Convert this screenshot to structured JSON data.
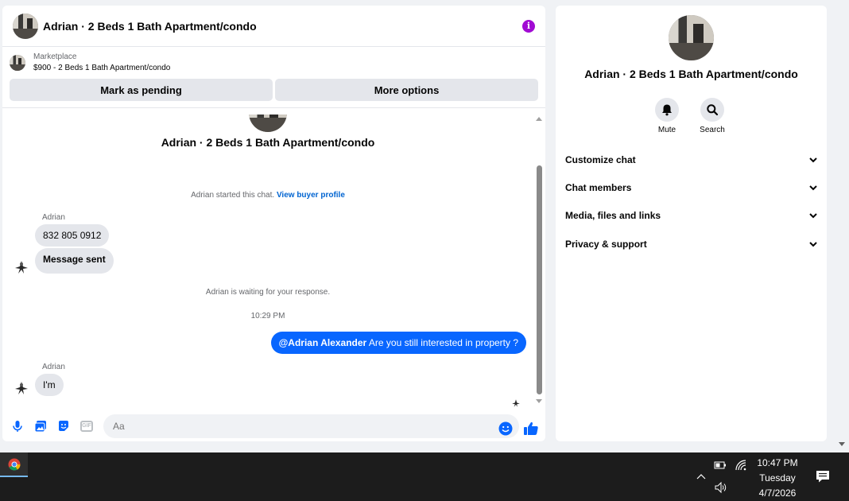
{
  "chat": {
    "header_title": "Adrian · 2 Beds 1 Bath Apartment/condo",
    "info_icon": "i",
    "marketplace_label": "Marketplace",
    "listing": "$900 - 2 Beds 1 Bath Apartment/condo",
    "actions": [
      "Mark as pending",
      "More options"
    ],
    "conversation_title": "Adrian · 2 Beds 1 Bath Apartment/condo",
    "started_text": "Adrian started this chat.",
    "view_profile": "View buyer profile",
    "messages_group1": {
      "sender": "Adrian",
      "bubbles": [
        "832 805 0912",
        "Message sent"
      ]
    },
    "waiting_text": "Adrian is waiting for your response.",
    "timestamp": "10:29 PM",
    "outgoing": {
      "mention": "@Adrian Alexander",
      "text": " Are you still interested in property ?"
    },
    "messages_group2": {
      "sender": "Adrian",
      "bubbles": [
        "I'm"
      ]
    },
    "composer_placeholder": "Aa",
    "gif_label": "GIF"
  },
  "info_panel": {
    "title": "Adrian · 2 Beds 1 Bath Apartment/condo",
    "buttons": [
      "Mute",
      "Search"
    ],
    "sections": [
      "Customize chat",
      "Chat members",
      "Media, files and links",
      "Privacy & support"
    ]
  },
  "taskbar": {
    "time": "10:47 PM",
    "day": "Tuesday",
    "date": "4/7/2026"
  },
  "colors": {
    "accent": "#0866ff",
    "info_purple": "#a10bd3",
    "bubble_in": "#e4e6eb",
    "link": "#0064d1"
  },
  "icons": [
    "mic-icon",
    "image-icon",
    "sticker-icon",
    "gif-icon",
    "emoji-icon",
    "like-icon",
    "bell-icon",
    "search-icon",
    "chevron-down-icon",
    "chrome-icon",
    "battery-icon",
    "wifi-icon",
    "volume-icon",
    "notification-icon"
  ]
}
